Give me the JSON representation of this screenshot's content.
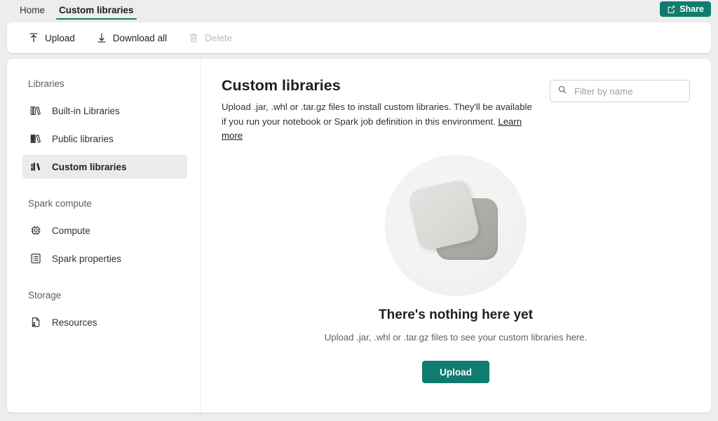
{
  "topbar": {
    "tabs": [
      {
        "label": "Home",
        "active": false
      },
      {
        "label": "Custom libraries",
        "active": true
      }
    ],
    "share": {
      "label": "Share",
      "icon": "share-icon",
      "color": "#107C6E"
    }
  },
  "commandbar": {
    "items": [
      {
        "label": "Upload",
        "icon": "upload-arrow-icon",
        "disabled": false
      },
      {
        "label": "Download all",
        "icon": "download-arrow-icon",
        "disabled": false
      },
      {
        "label": "Delete",
        "icon": "trash-icon",
        "disabled": true
      }
    ]
  },
  "sidebar": {
    "groups": [
      {
        "title": "Libraries",
        "items": [
          {
            "label": "Built-in Libraries",
            "icon": "books-outline-icon",
            "selected": false
          },
          {
            "label": "Public libraries",
            "icon": "books-globe-icon",
            "selected": false
          },
          {
            "label": "Custom libraries",
            "icon": "books-filled-icon",
            "selected": true
          }
        ]
      },
      {
        "title": "Spark compute",
        "items": [
          {
            "label": "Compute",
            "icon": "cpu-chip-icon",
            "selected": false
          },
          {
            "label": "Spark properties",
            "icon": "list-document-icon",
            "selected": false
          }
        ]
      },
      {
        "title": "Storage",
        "items": [
          {
            "label": "Resources",
            "icon": "file-person-icon",
            "selected": false
          }
        ]
      }
    ]
  },
  "main": {
    "title": "Custom libraries",
    "description_part1": "Upload .jar, .whl or .tar.gz files to install custom libraries. They'll be available if you run your notebook or Spark job definition in this environment. ",
    "learn_more": "Learn more",
    "filter": {
      "placeholder": "Filter by name",
      "value": "",
      "icon": "search-icon"
    },
    "empty_state": {
      "illustration": "stacked-squares-illustration",
      "title": "There's nothing here yet",
      "subtitle": "Upload .jar, .whl or .tar.gz files to see your custom libraries here.",
      "cta_label": "Upload"
    }
  },
  "colors": {
    "accent": "#107C6E",
    "page_background": "#EDEDED",
    "card_background": "#FFFFFF",
    "selected_item": "#EDEBE9"
  }
}
